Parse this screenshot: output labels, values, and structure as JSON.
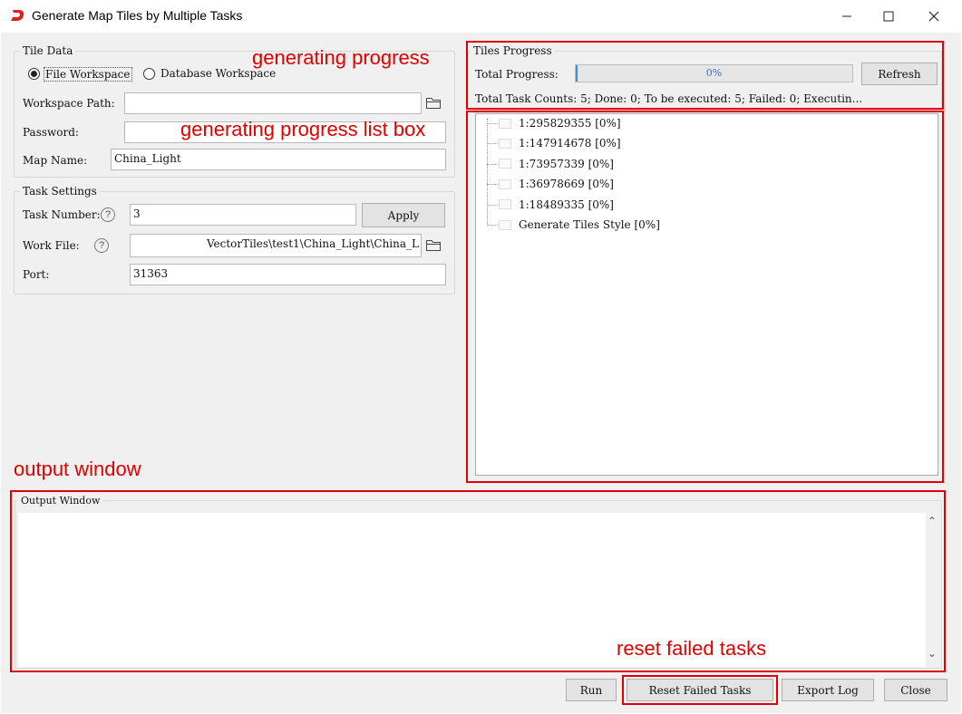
{
  "window": {
    "title": "Generate Map Tiles by Multiple Tasks",
    "controls": {
      "minimize": "—",
      "maximize": "☐",
      "close": "✕"
    }
  },
  "tile_data": {
    "title": "Tile Data",
    "radio_file": "File Workspace",
    "radio_database": "Database Workspace",
    "selected": "File Workspace",
    "workspace_path_label": "Workspace Path:",
    "workspace_path_value": "",
    "password_label": "Password:",
    "password_value": "",
    "map_name_label": "Map Name:",
    "map_name_value": "China_Light"
  },
  "task_settings": {
    "title": "Task Settings",
    "task_number_label": "Task Number:",
    "task_number_value": "3",
    "apply_label": "Apply",
    "work_file_label": "Work File:",
    "work_file_value": "VectorTiles\\test1\\China_Light\\China_L",
    "port_label": "Port:",
    "port_value": "31363",
    "help_glyph": "?"
  },
  "tiles_progress": {
    "title": "Tiles Progress",
    "total_progress_label": "Total Progress:",
    "progress_percent": 0,
    "progress_text": "0%",
    "refresh_label": "Refresh",
    "summary": "Total Task Counts: 5; Done: 0; To be executed: 5; Failed: 0; Executin..."
  },
  "tree_items": [
    {
      "label": "1:295829355 [0%]"
    },
    {
      "label": "1:147914678 [0%]"
    },
    {
      "label": "1:73957339 [0%]"
    },
    {
      "label": "1:36978669 [0%]"
    },
    {
      "label": "1:18489335 [0%]"
    },
    {
      "label": "Generate Tiles Style [0%]"
    }
  ],
  "output_window": {
    "title": "Output Window",
    "content": "",
    "scroll_up": "⌃",
    "scroll_down": "⌄"
  },
  "buttons": {
    "run": "Run",
    "reset_failed": "Reset Failed Tasks",
    "export_log": "Export Log",
    "close": "Close"
  },
  "annotations": {
    "generating_progress": "generating progress",
    "progress_list_box": "generating progress list box",
    "output_window": "output window",
    "reset_failed_tasks": "reset failed tasks"
  },
  "colors": {
    "annotation_red": "#e00000",
    "logo_red": "#e0201b",
    "progress_blue": "#3d8ee0"
  },
  "icons": {
    "logo": "app-logo-icon",
    "folder": "folder-icon",
    "help": "help-icon"
  }
}
